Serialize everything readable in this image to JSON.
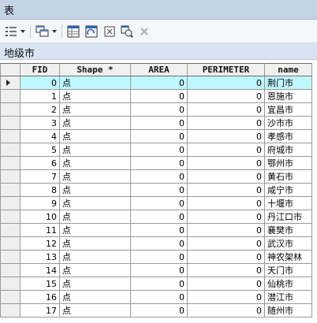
{
  "window": {
    "title": "表"
  },
  "toolbar": {
    "buttons": [
      {
        "name": "table-options-icon"
      },
      {
        "name": "related-tables-icon"
      },
      {
        "name": "select-by-attributes-icon"
      },
      {
        "name": "switch-selection-icon"
      },
      {
        "name": "clear-selection-icon"
      },
      {
        "name": "zoom-to-selected-icon"
      },
      {
        "name": "delete-selected-icon"
      }
    ]
  },
  "layer": {
    "name": "地级市"
  },
  "table": {
    "columns": [
      "FID",
      "Shape *",
      "AREA",
      "PERIMETER",
      "name"
    ],
    "rows": [
      {
        "fid": "0",
        "shape": "点",
        "area": "0",
        "perimeter": "0",
        "name": "荆门市"
      },
      {
        "fid": "1",
        "shape": "点",
        "area": "0",
        "perimeter": "0",
        "name": "恩施市"
      },
      {
        "fid": "2",
        "shape": "点",
        "area": "0",
        "perimeter": "0",
        "name": "宜昌市"
      },
      {
        "fid": "3",
        "shape": "点",
        "area": "0",
        "perimeter": "0",
        "name": "沙市市"
      },
      {
        "fid": "4",
        "shape": "点",
        "area": "0",
        "perimeter": "0",
        "name": "孝感市"
      },
      {
        "fid": "5",
        "shape": "点",
        "area": "0",
        "perimeter": "0",
        "name": "府城市"
      },
      {
        "fid": "6",
        "shape": "点",
        "area": "0",
        "perimeter": "0",
        "name": "鄂州市"
      },
      {
        "fid": "7",
        "shape": "点",
        "area": "0",
        "perimeter": "0",
        "name": "黄石市"
      },
      {
        "fid": "8",
        "shape": "点",
        "area": "0",
        "perimeter": "0",
        "name": "咸宁市"
      },
      {
        "fid": "9",
        "shape": "点",
        "area": "0",
        "perimeter": "0",
        "name": "十堰市"
      },
      {
        "fid": "10",
        "shape": "点",
        "area": "0",
        "perimeter": "0",
        "name": "丹江口市"
      },
      {
        "fid": "11",
        "shape": "点",
        "area": "0",
        "perimeter": "0",
        "name": "襄樊市"
      },
      {
        "fid": "12",
        "shape": "点",
        "area": "0",
        "perimeter": "0",
        "name": "武汉市"
      },
      {
        "fid": "13",
        "shape": "点",
        "area": "0",
        "perimeter": "0",
        "name": "神农架林"
      },
      {
        "fid": "14",
        "shape": "点",
        "area": "0",
        "perimeter": "0",
        "name": "天门市"
      },
      {
        "fid": "15",
        "shape": "点",
        "area": "0",
        "perimeter": "0",
        "name": "仙桃市"
      },
      {
        "fid": "16",
        "shape": "点",
        "area": "0",
        "perimeter": "0",
        "name": "潜江市"
      },
      {
        "fid": "17",
        "shape": "点",
        "area": "0",
        "perimeter": "0",
        "name": "随州市"
      }
    ]
  }
}
